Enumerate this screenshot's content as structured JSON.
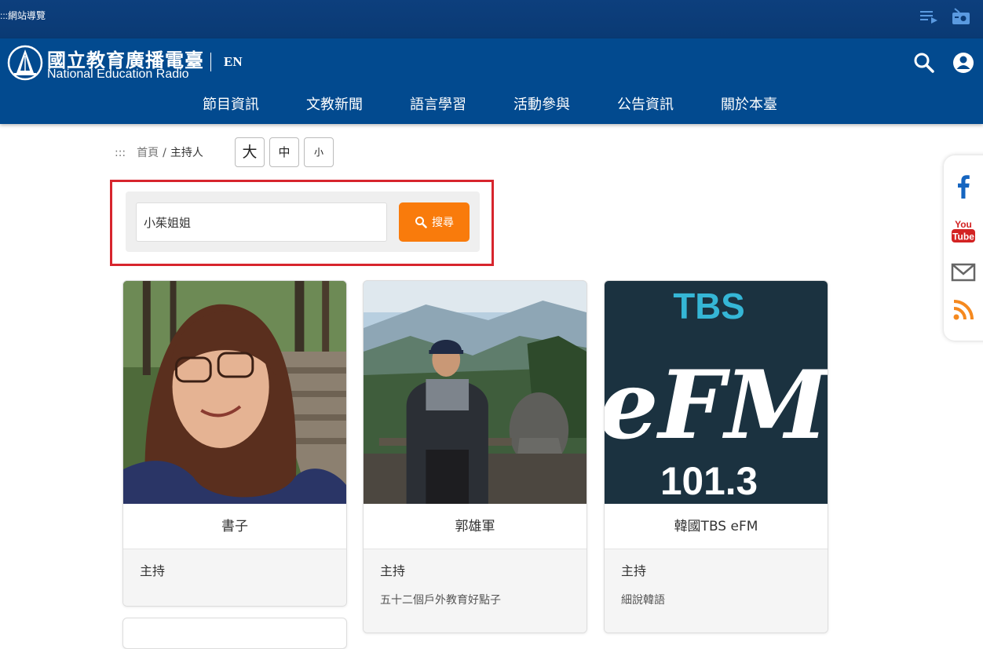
{
  "topbar": {
    "sitemap": ":::網站導覽",
    "playlist_icon": "playlist-icon",
    "radio_icon": "radio-icon"
  },
  "header": {
    "logo_zh": "國立教育廣播電臺",
    "logo_en": "National Education Radio",
    "lang": "EN",
    "search_icon": "search-icon",
    "user_icon": "user-icon",
    "bg_color": "#024a8f"
  },
  "nav": [
    "節目資訊",
    "文教新聞",
    "語言學習",
    "活動參與",
    "公告資訊",
    "關於本臺"
  ],
  "breadcrumb": {
    "marker": ":::",
    "home": "首頁",
    "current": "主持人"
  },
  "font_size": {
    "large": "大",
    "medium": "中",
    "small": "小"
  },
  "search": {
    "value": "小茱姐姐",
    "button": "搜尋",
    "button_color": "#f97b0c",
    "highlight_color": "#d7252d"
  },
  "social": [
    "facebook-icon",
    "youtube-icon",
    "mail-icon",
    "rss-icon"
  ],
  "social_youtube": {
    "line1": "You",
    "line2": "Tube"
  },
  "cards": [
    {
      "name": "書子",
      "role": "主持",
      "program": ""
    },
    {
      "name": "郭雄軍",
      "role": "主持",
      "program": "五十二個戶外教育好點子"
    },
    {
      "name": "韓國TBS eFM",
      "role": "主持",
      "program": "細說韓語"
    }
  ],
  "efm_logo": {
    "top": "TBS",
    "main": "eFM",
    "freq": "101.3"
  }
}
